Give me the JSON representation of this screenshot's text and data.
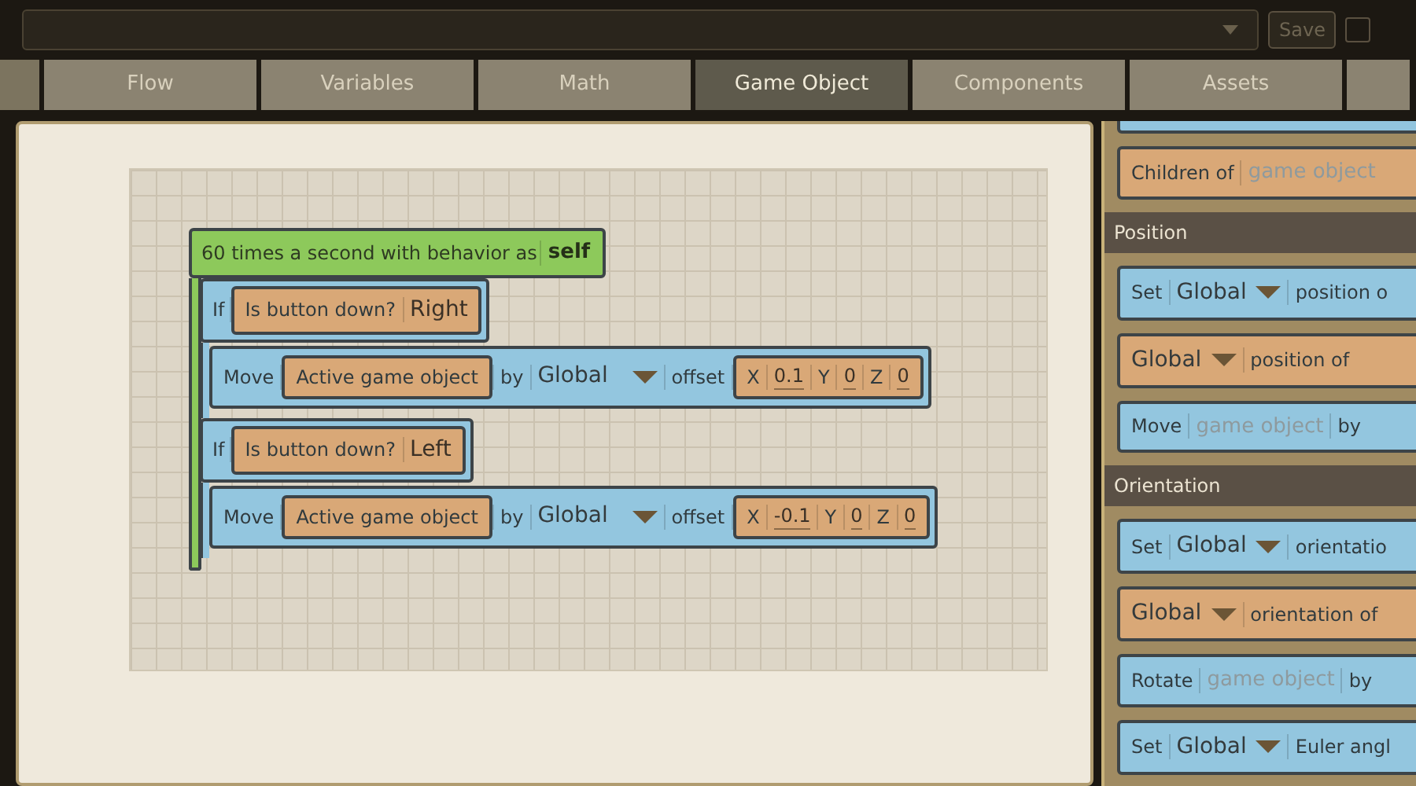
{
  "toolbar": {
    "save": "Save",
    "checked": false
  },
  "tabs": [
    {
      "label": "Flow",
      "selected": false
    },
    {
      "label": "Variables",
      "selected": false
    },
    {
      "label": "Math",
      "selected": false
    },
    {
      "label": "Game Object",
      "selected": true
    },
    {
      "label": "Components",
      "selected": false
    },
    {
      "label": "Assets",
      "selected": false
    }
  ],
  "script": {
    "event": {
      "label": "60 times a second with behavior as",
      "target": "self"
    },
    "statements": [
      {
        "kind": "if",
        "label": "If",
        "condition": {
          "kind": "expression",
          "parts": [
            {
              "kind": "text",
              "text": "Is button down?"
            },
            {
              "kind": "value",
              "text": "Right"
            }
          ]
        },
        "body": [
          {
            "kind": "action",
            "parts": [
              {
                "kind": "text",
                "text": "Move"
              },
              {
                "kind": "block",
                "block": {
                  "kind": "expression",
                  "parts": [
                    {
                      "kind": "text",
                      "text": "Active game object"
                    }
                  ]
                }
              },
              {
                "kind": "text",
                "text": "by"
              },
              {
                "kind": "dropdown",
                "text": "Global"
              },
              {
                "kind": "text",
                "text": "offset"
              },
              {
                "kind": "block",
                "block": {
                  "kind": "expression",
                  "parts": [
                    {
                      "kind": "text",
                      "text": "X"
                    },
                    {
                      "kind": "field",
                      "text": "0.1"
                    },
                    {
                      "kind": "text",
                      "text": "Y"
                    },
                    {
                      "kind": "field",
                      "text": "0"
                    },
                    {
                      "kind": "text",
                      "text": "Z"
                    },
                    {
                      "kind": "field",
                      "text": "0"
                    }
                  ]
                }
              }
            ]
          }
        ]
      },
      {
        "kind": "if",
        "label": "If",
        "condition": {
          "kind": "expression",
          "parts": [
            {
              "kind": "text",
              "text": "Is button down?"
            },
            {
              "kind": "value",
              "text": "Left"
            }
          ]
        },
        "body": [
          {
            "kind": "action",
            "parts": [
              {
                "kind": "text",
                "text": "Move"
              },
              {
                "kind": "block",
                "block": {
                  "kind": "expression",
                  "parts": [
                    {
                      "kind": "text",
                      "text": "Active game object"
                    }
                  ]
                }
              },
              {
                "kind": "text",
                "text": "by"
              },
              {
                "kind": "dropdown",
                "text": "Global"
              },
              {
                "kind": "text",
                "text": "offset"
              },
              {
                "kind": "block",
                "block": {
                  "kind": "expression",
                  "parts": [
                    {
                      "kind": "text",
                      "text": "X"
                    },
                    {
                      "kind": "field",
                      "text": "-0.1"
                    },
                    {
                      "kind": "text",
                      "text": "Y"
                    },
                    {
                      "kind": "field",
                      "text": "0"
                    },
                    {
                      "kind": "text",
                      "text": "Z"
                    },
                    {
                      "kind": "field",
                      "text": "0"
                    }
                  ]
                }
              }
            ]
          }
        ]
      }
    ]
  },
  "palette": [
    {
      "kind": "expression",
      "parts": [
        {
          "kind": "text",
          "text": "Children of"
        },
        {
          "kind": "placeholder",
          "text": "game object"
        }
      ]
    },
    {
      "kind": "header",
      "text": "Position"
    },
    {
      "kind": "action",
      "parts": [
        {
          "kind": "text",
          "text": "Set"
        },
        {
          "kind": "dropdown",
          "text": "Global"
        },
        {
          "kind": "text",
          "text": "position o"
        }
      ]
    },
    {
      "kind": "expression",
      "parts": [
        {
          "kind": "dropdown",
          "text": "Global"
        },
        {
          "kind": "text",
          "text": "position of"
        }
      ]
    },
    {
      "kind": "action",
      "parts": [
        {
          "kind": "text",
          "text": "Move"
        },
        {
          "kind": "placeholder",
          "text": "game object"
        },
        {
          "kind": "text",
          "text": "by"
        }
      ]
    },
    {
      "kind": "header",
      "text": "Orientation"
    },
    {
      "kind": "action",
      "parts": [
        {
          "kind": "text",
          "text": "Set"
        },
        {
          "kind": "dropdown",
          "text": "Global"
        },
        {
          "kind": "text",
          "text": "orientatio"
        }
      ]
    },
    {
      "kind": "expression",
      "parts": [
        {
          "kind": "dropdown",
          "text": "Global"
        },
        {
          "kind": "text",
          "text": "orientation of"
        }
      ]
    },
    {
      "kind": "action",
      "parts": [
        {
          "kind": "text",
          "text": "Rotate"
        },
        {
          "kind": "placeholder",
          "text": "game object"
        },
        {
          "kind": "text",
          "text": "by"
        }
      ]
    },
    {
      "kind": "action",
      "parts": [
        {
          "kind": "text",
          "text": "Set"
        },
        {
          "kind": "dropdown",
          "text": "Global"
        },
        {
          "kind": "text",
          "text": "Euler angl"
        }
      ]
    }
  ]
}
